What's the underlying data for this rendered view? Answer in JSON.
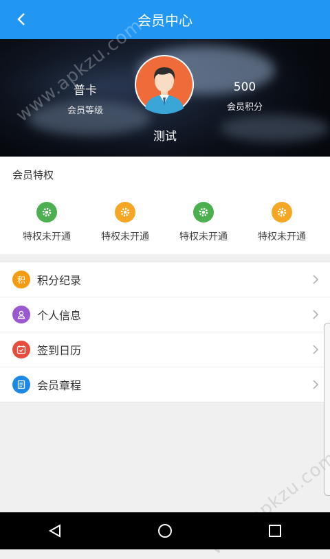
{
  "header": {
    "title": "会员中心",
    "back_icon": "chevron-left-icon"
  },
  "profile": {
    "level_value": "普卡",
    "level_label": "会员等级",
    "points_value": "500",
    "points_label": "会员积分",
    "username": "测试"
  },
  "privileges": {
    "title": "会员特权",
    "items": [
      {
        "label": "特权未开通",
        "color": "#4caf50",
        "icon": "gear-icon"
      },
      {
        "label": "特权未开通",
        "color": "#f5a623",
        "icon": "gear-icon"
      },
      {
        "label": "特权未开通",
        "color": "#4caf50",
        "icon": "gear-icon"
      },
      {
        "label": "特权未开通",
        "color": "#f5a623",
        "icon": "gear-icon"
      }
    ]
  },
  "menu": [
    {
      "label": "积分纪录",
      "icon_text": "积",
      "color": "#f39c12",
      "icon": "points-icon"
    },
    {
      "label": "个人信息",
      "color": "#9b59d0",
      "icon": "user-icon"
    },
    {
      "label": "签到日历",
      "color": "#e74c3c",
      "icon": "calendar-icon"
    },
    {
      "label": "会员章程",
      "color": "#1e88e5",
      "icon": "document-icon"
    }
  ],
  "watermark": "www.apkzu.com",
  "colors": {
    "primary": "#2196f3"
  }
}
